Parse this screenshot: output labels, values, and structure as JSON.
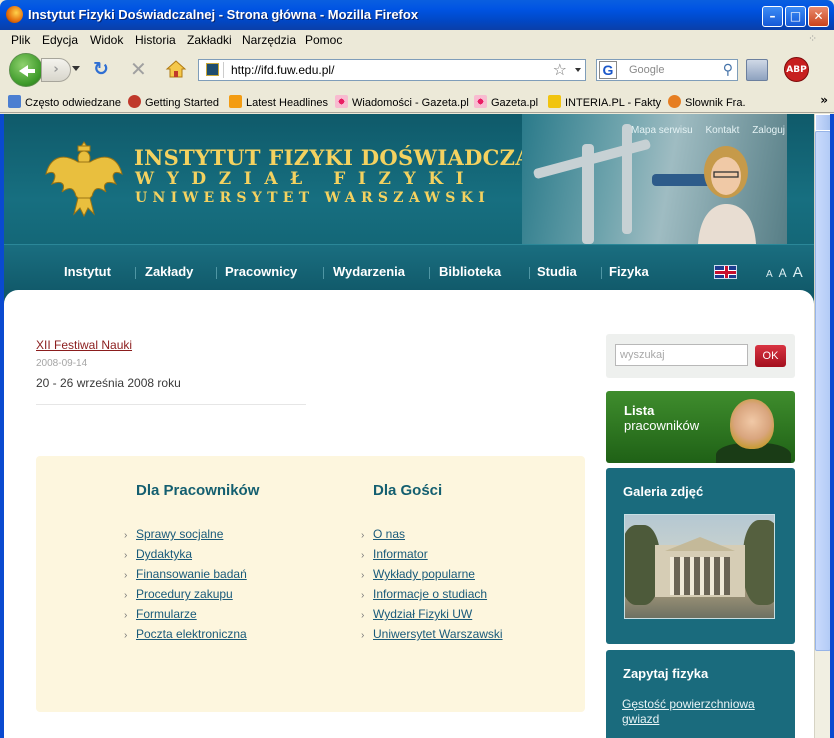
{
  "window": {
    "title": "Instytut Fizyki Doświadczalnej - Strona główna - Mozilla Firefox"
  },
  "menu": [
    "Plik",
    "Edycja",
    "Widok",
    "Historia",
    "Zakładki",
    "Narzędzia",
    "Pomoc"
  ],
  "toolbar": {
    "url": "http://ifd.fuw.edu.pl/",
    "search_placeholder": "Google",
    "abp_label": "ABP"
  },
  "bookmarks": [
    "Często odwiedzane",
    "Getting Started",
    "Latest Headlines",
    "Wiadomości - Gazeta.pl",
    "Gazeta.pl",
    "INTERIA.PL - Fakty",
    "Slownik Fra."
  ],
  "header": {
    "line1": "INSTYTUT FIZYKI DOŚWIADCZALNEJ",
    "line2": "WYDZIAŁ FIZYKI",
    "line3": "UNIWERSYTET WARSZAWSKI",
    "toplinks": [
      "Mapa serwisu",
      "Kontakt",
      "Zaloguj"
    ],
    "nav": [
      "Instytut",
      "Zakłady",
      "Pracownicy",
      "Wydarzenia",
      "Biblioteka",
      "Studia",
      "Fizyka"
    ],
    "font_sizes": [
      "A",
      "A",
      "A"
    ]
  },
  "news": {
    "title": "XII Festiwal Nauki",
    "date": "2008-09-14",
    "body": "20 - 26 września 2008 roku"
  },
  "for_staff": {
    "heading": "Dla Pracowników",
    "links": [
      "Sprawy socjalne",
      "Dydaktyka",
      "Finansowanie badań",
      "Procedury zakupu",
      "Formularze",
      "Poczta elektroniczna"
    ]
  },
  "for_guests": {
    "heading": "Dla Gości",
    "links": [
      "O nas",
      "Informator",
      "Wykłady popularne",
      "Informacje o studiach",
      "Wydział Fizyki UW",
      "Uniwersytet Warszawski"
    ]
  },
  "sidebar": {
    "search_placeholder": "wyszukaj",
    "search_button": "OK",
    "staff_line1": "Lista",
    "staff_line2": "pracowników",
    "gallery_title": "Galeria zdjęć",
    "ask_title": "Zapytaj fizyka",
    "ask_question": "Gęstość powierzchniowa gwiazd"
  },
  "colors": {
    "header_teal": "#176f80",
    "gold": "#f4d260",
    "link_red": "#8b1d1d",
    "ok_red": "#c12030",
    "staff_green": "#2f7a22"
  }
}
